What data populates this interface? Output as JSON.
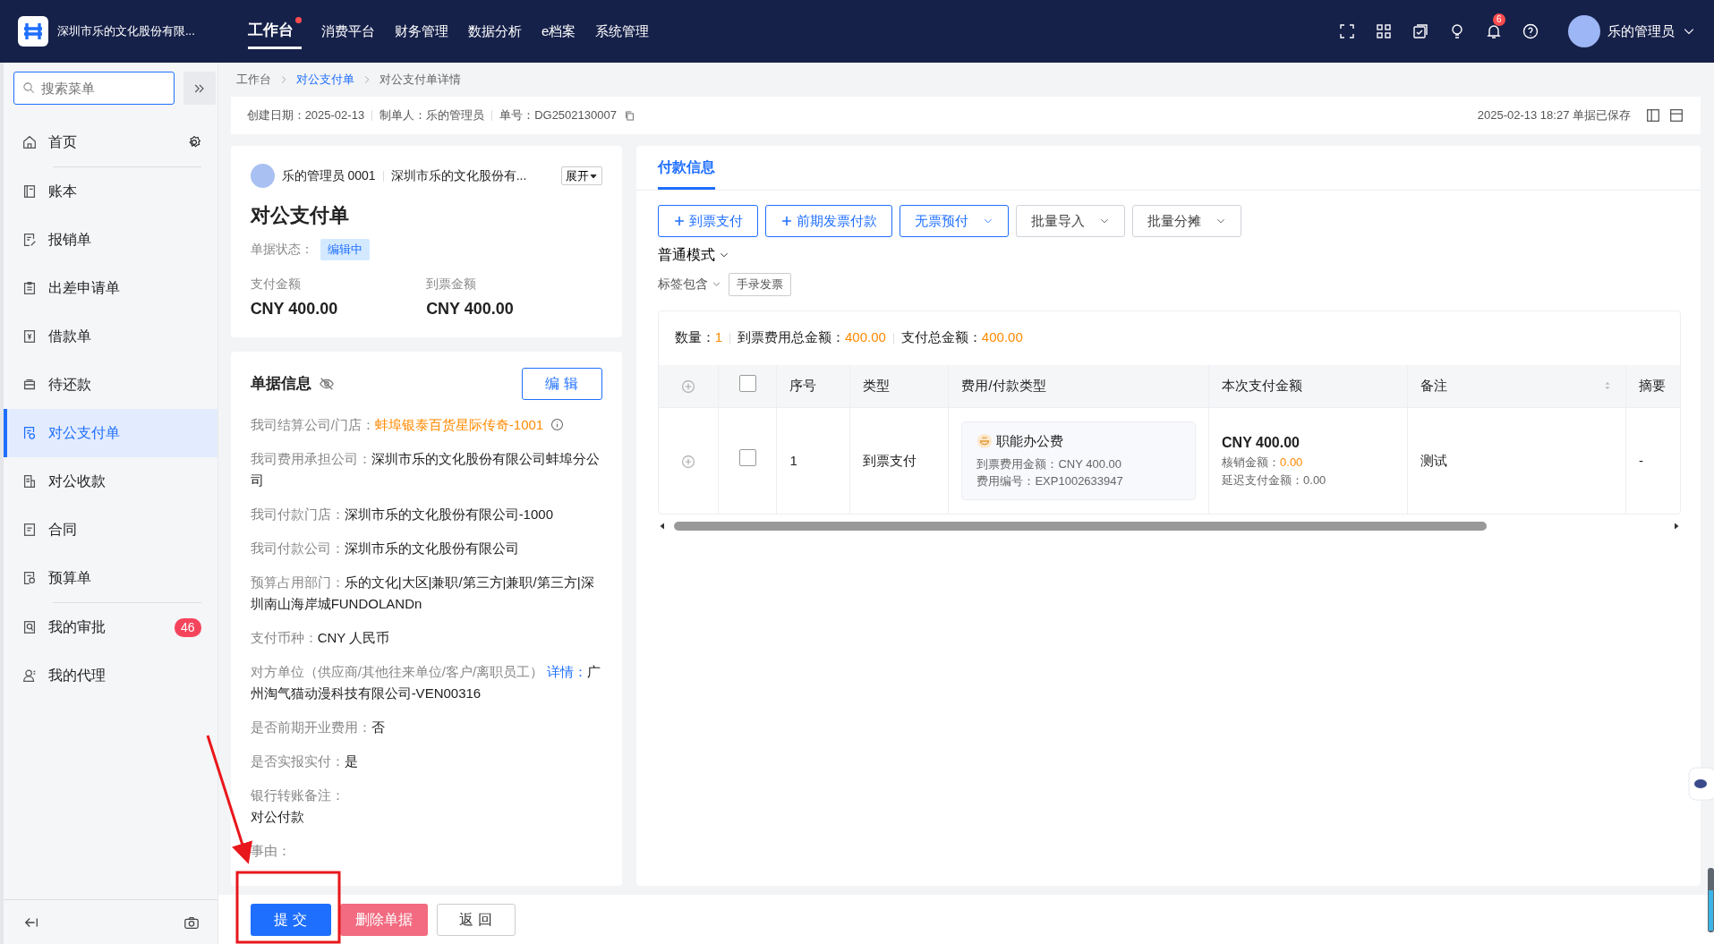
{
  "header": {
    "company": "深圳市乐的文化股份有限...",
    "nav": [
      {
        "label": "工作台",
        "selected": true,
        "dot": true
      },
      {
        "label": "消费平台",
        "selected": false,
        "dot": false
      },
      {
        "label": "财务管理",
        "selected": false,
        "dot": false
      },
      {
        "label": "数据分析",
        "selected": false,
        "dot": false
      },
      {
        "label": "e档案",
        "selected": false,
        "dot": false
      },
      {
        "label": "系统管理",
        "selected": false,
        "dot": false
      }
    ],
    "notification_count": "6",
    "user": "乐的管理员"
  },
  "sidebar": {
    "search": {
      "placeholder": "搜索菜单"
    },
    "groups": [
      [
        {
          "label": "首页",
          "selected": false,
          "gear": true
        }
      ],
      [
        {
          "label": "账本",
          "selected": false
        },
        {
          "label": "报销单",
          "selected": false
        },
        {
          "label": "出差申请单",
          "selected": false
        },
        {
          "label": "借款单",
          "selected": false
        },
        {
          "label": "待还款",
          "selected": false
        },
        {
          "label": "对公支付单",
          "selected": true
        },
        {
          "label": "对公收款",
          "selected": false
        },
        {
          "label": "合同",
          "selected": false
        },
        {
          "label": "预算单",
          "selected": false
        }
      ],
      [
        {
          "label": "我的审批",
          "selected": false,
          "badge": "46"
        },
        {
          "label": "我的代理",
          "selected": false
        }
      ]
    ]
  },
  "breadcrumb": [
    {
      "label": "工作台",
      "kind": "plain"
    },
    {
      "label": "对公支付单",
      "kind": "link"
    },
    {
      "label": "对公支付单详情",
      "kind": "current"
    }
  ],
  "meta": {
    "fields": [
      {
        "label": "创建日期：",
        "value": "2025-02-13"
      },
      {
        "label": "制单人：",
        "value": "乐的管理员"
      },
      {
        "label": "单号：",
        "value": "DG2502130007"
      }
    ],
    "saved": "2025-02-13 18:27 单据已保存"
  },
  "summary": {
    "user": "乐的管理员 0001",
    "company": "深圳市乐的文化股份有...",
    "expand": "展开",
    "title": "对公支付单",
    "status_label": "单据状态：",
    "status": "编辑中",
    "amounts": [
      {
        "label": "支付金额",
        "value": "CNY 400.00"
      },
      {
        "label": "到票金额",
        "value": "CNY 400.00"
      }
    ]
  },
  "info": {
    "title": "单据信息",
    "edit": "编 辑",
    "fields": [
      {
        "kind": "highlight",
        "label": "我司结算公司/门店：",
        "value": "蚌埠银泰百货星际传奇-1001"
      },
      {
        "kind": "inline",
        "label": "我司费用承担公司：",
        "value": "深圳市乐的文化股份有限公司蚌埠分公司"
      },
      {
        "kind": "inline",
        "label": "我司付款门店：",
        "value": "深圳市乐的文化股份有限公司-1000"
      },
      {
        "kind": "inline",
        "label": "我司付款公司：",
        "value": "深圳市乐的文化股份有限公司"
      },
      {
        "kind": "inline",
        "label": "预算占用部门：",
        "value": "乐的文化|大区|兼职/第三方|兼职/第三方|深圳南山海岸城FUNDOLANDn"
      },
      {
        "kind": "inline",
        "label": "支付币种：",
        "value": "CNY 人民币"
      },
      {
        "kind": "link",
        "label": "对方单位（供应商/其他往来单位/客户/离职员工）",
        "link": "详情：",
        "value": "广州淘气猫动漫科技有限公司-VEN00316"
      },
      {
        "kind": "inline",
        "label": "是否前期开业费用：",
        "value": "否"
      },
      {
        "kind": "inline",
        "label": "是否实报实付：",
        "value": "是"
      },
      {
        "kind": "block",
        "label": "银行转账备注：",
        "value": "对公付款"
      },
      {
        "kind": "block",
        "label": "事由："
      }
    ]
  },
  "payment": {
    "tabs": [
      {
        "label": "付款信息",
        "selected": true
      }
    ],
    "buttons": [
      {
        "label": "到票支付",
        "kind": "primary-plus"
      },
      {
        "label": "前期发票付款",
        "kind": "primary-plus"
      },
      {
        "label": "无票预付",
        "kind": "primary-dropdown"
      },
      {
        "label": "批量导入",
        "kind": "default-dropdown"
      },
      {
        "label": "批量分摊",
        "kind": "default-dropdown"
      }
    ],
    "mode": "普通模式",
    "tag_filter": "标签包含",
    "tag": "手录发票",
    "totals": [
      {
        "label": "数量：",
        "value": "1"
      },
      {
        "label": "到票费用总金额：",
        "value": "400.00"
      },
      {
        "label": "支付总金额：",
        "value": "400.00"
      }
    ],
    "table": {
      "select_all": {
        "checked": false
      },
      "columns": [
        "序号",
        "类型",
        "费用/付款类型",
        "本次支付金额",
        "备注",
        "摘要"
      ],
      "rows": [
        {
          "checked": false,
          "index": "1",
          "type": "到票支付",
          "expense": "职能办公费",
          "expense_amount": "到票费用金额：CNY 400.00",
          "expense_code": "费用编号：EXP1002633947",
          "amount": "CNY 400.00",
          "writeoff_label": "核销金额：",
          "writeoff": "0.00",
          "deferred": "延迟支付金额：0.00",
          "note": "测试",
          "summary": "-"
        }
      ]
    }
  },
  "footer": [
    {
      "label": "提 交",
      "kind": "primary"
    },
    {
      "label": "删除单据",
      "kind": "danger"
    },
    {
      "label": "返 回",
      "kind": "default"
    }
  ]
}
